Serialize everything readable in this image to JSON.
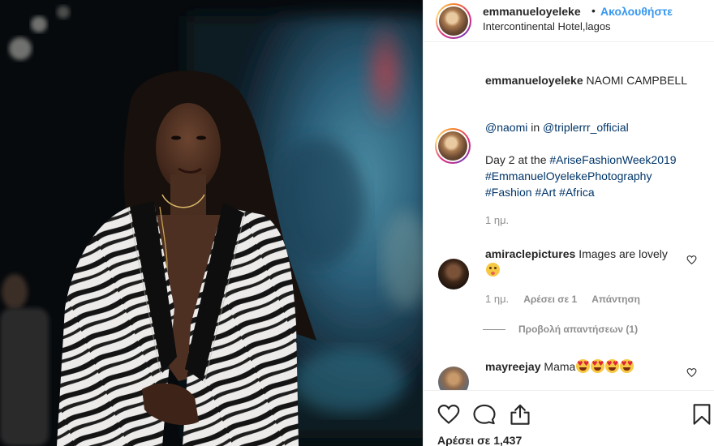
{
  "post": {
    "username": "emmanueloyeleke",
    "separator": "•",
    "follow_label": "Ακολουθήστε",
    "location": "Intercontinental Hotel,lagos"
  },
  "caption": {
    "username": "emmanueloyeleke",
    "title": "NAOMI CAMPBELL",
    "mention_user": "@naomi",
    "mention_in": "in",
    "mention_brand": "@triplerrr_official",
    "line_prefix": "Day 2 at the",
    "tag1": "#AriseFashionWeek2019",
    "tag2": "#EmmanuelOyelekePhotography",
    "tag3": "#Fashion",
    "tag4": "#Art",
    "tag5": "#Africa",
    "time": "1 ημ."
  },
  "comments": [
    {
      "username": "amiraclepictures",
      "text": "Images are lovely",
      "time": "1 ημ.",
      "likes": "Αρέσει σε 1",
      "reply": "Απάντηση",
      "view_replies": "Προβολή απαντήσεων (1)"
    },
    {
      "username": "mayreejay",
      "text": "Mama"
    }
  ],
  "actions": {
    "likes_text": "Αρέσει σε 1,437",
    "icons": [
      "heart-icon",
      "comment-icon",
      "share-icon",
      "bookmark-icon"
    ]
  },
  "colors": {
    "link": "#003569",
    "follow": "#3897f0",
    "meta": "#8e8e8e",
    "text": "#262626"
  }
}
